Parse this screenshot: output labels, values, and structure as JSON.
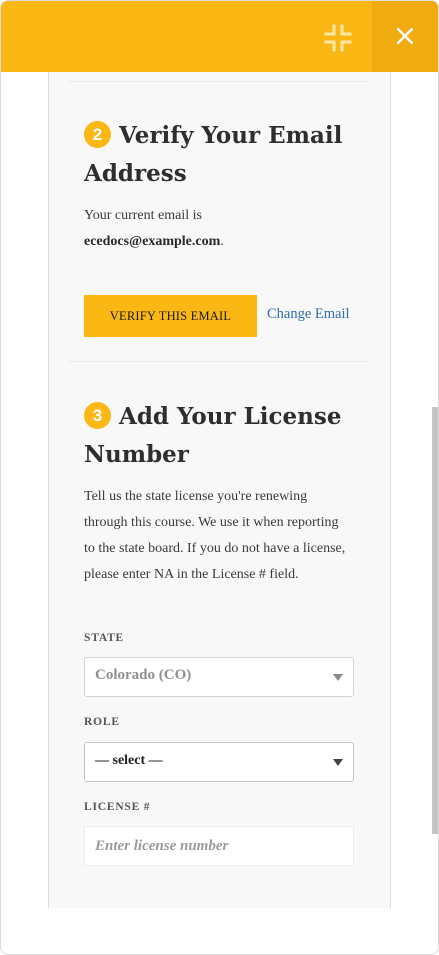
{
  "topbar": {
    "accent_color": "#fbb714",
    "shrink_icon": "shrink-icon",
    "close_icon": "close-icon"
  },
  "email_step": {
    "number": "2",
    "title": "Verify Your Email Address",
    "text_prefix": "Your current email is",
    "email": "ecedocs@example.com",
    "text_suffix": ".",
    "verify_label": "VERIFY THIS EMAIL",
    "change_label": "Change Email"
  },
  "license_step": {
    "number": "3",
    "title": "Add Your License Number",
    "description": "Tell us the state license you're renewing through this course. We use it when reporting to the state board. If you do not have a license, please enter NA in the License # field.",
    "state_label": "STATE",
    "state_value": "Colorado (CO)",
    "role_label": "ROLE",
    "role_value": "— select —",
    "license_label": "LICENSE #",
    "license_placeholder": "Enter license number"
  }
}
